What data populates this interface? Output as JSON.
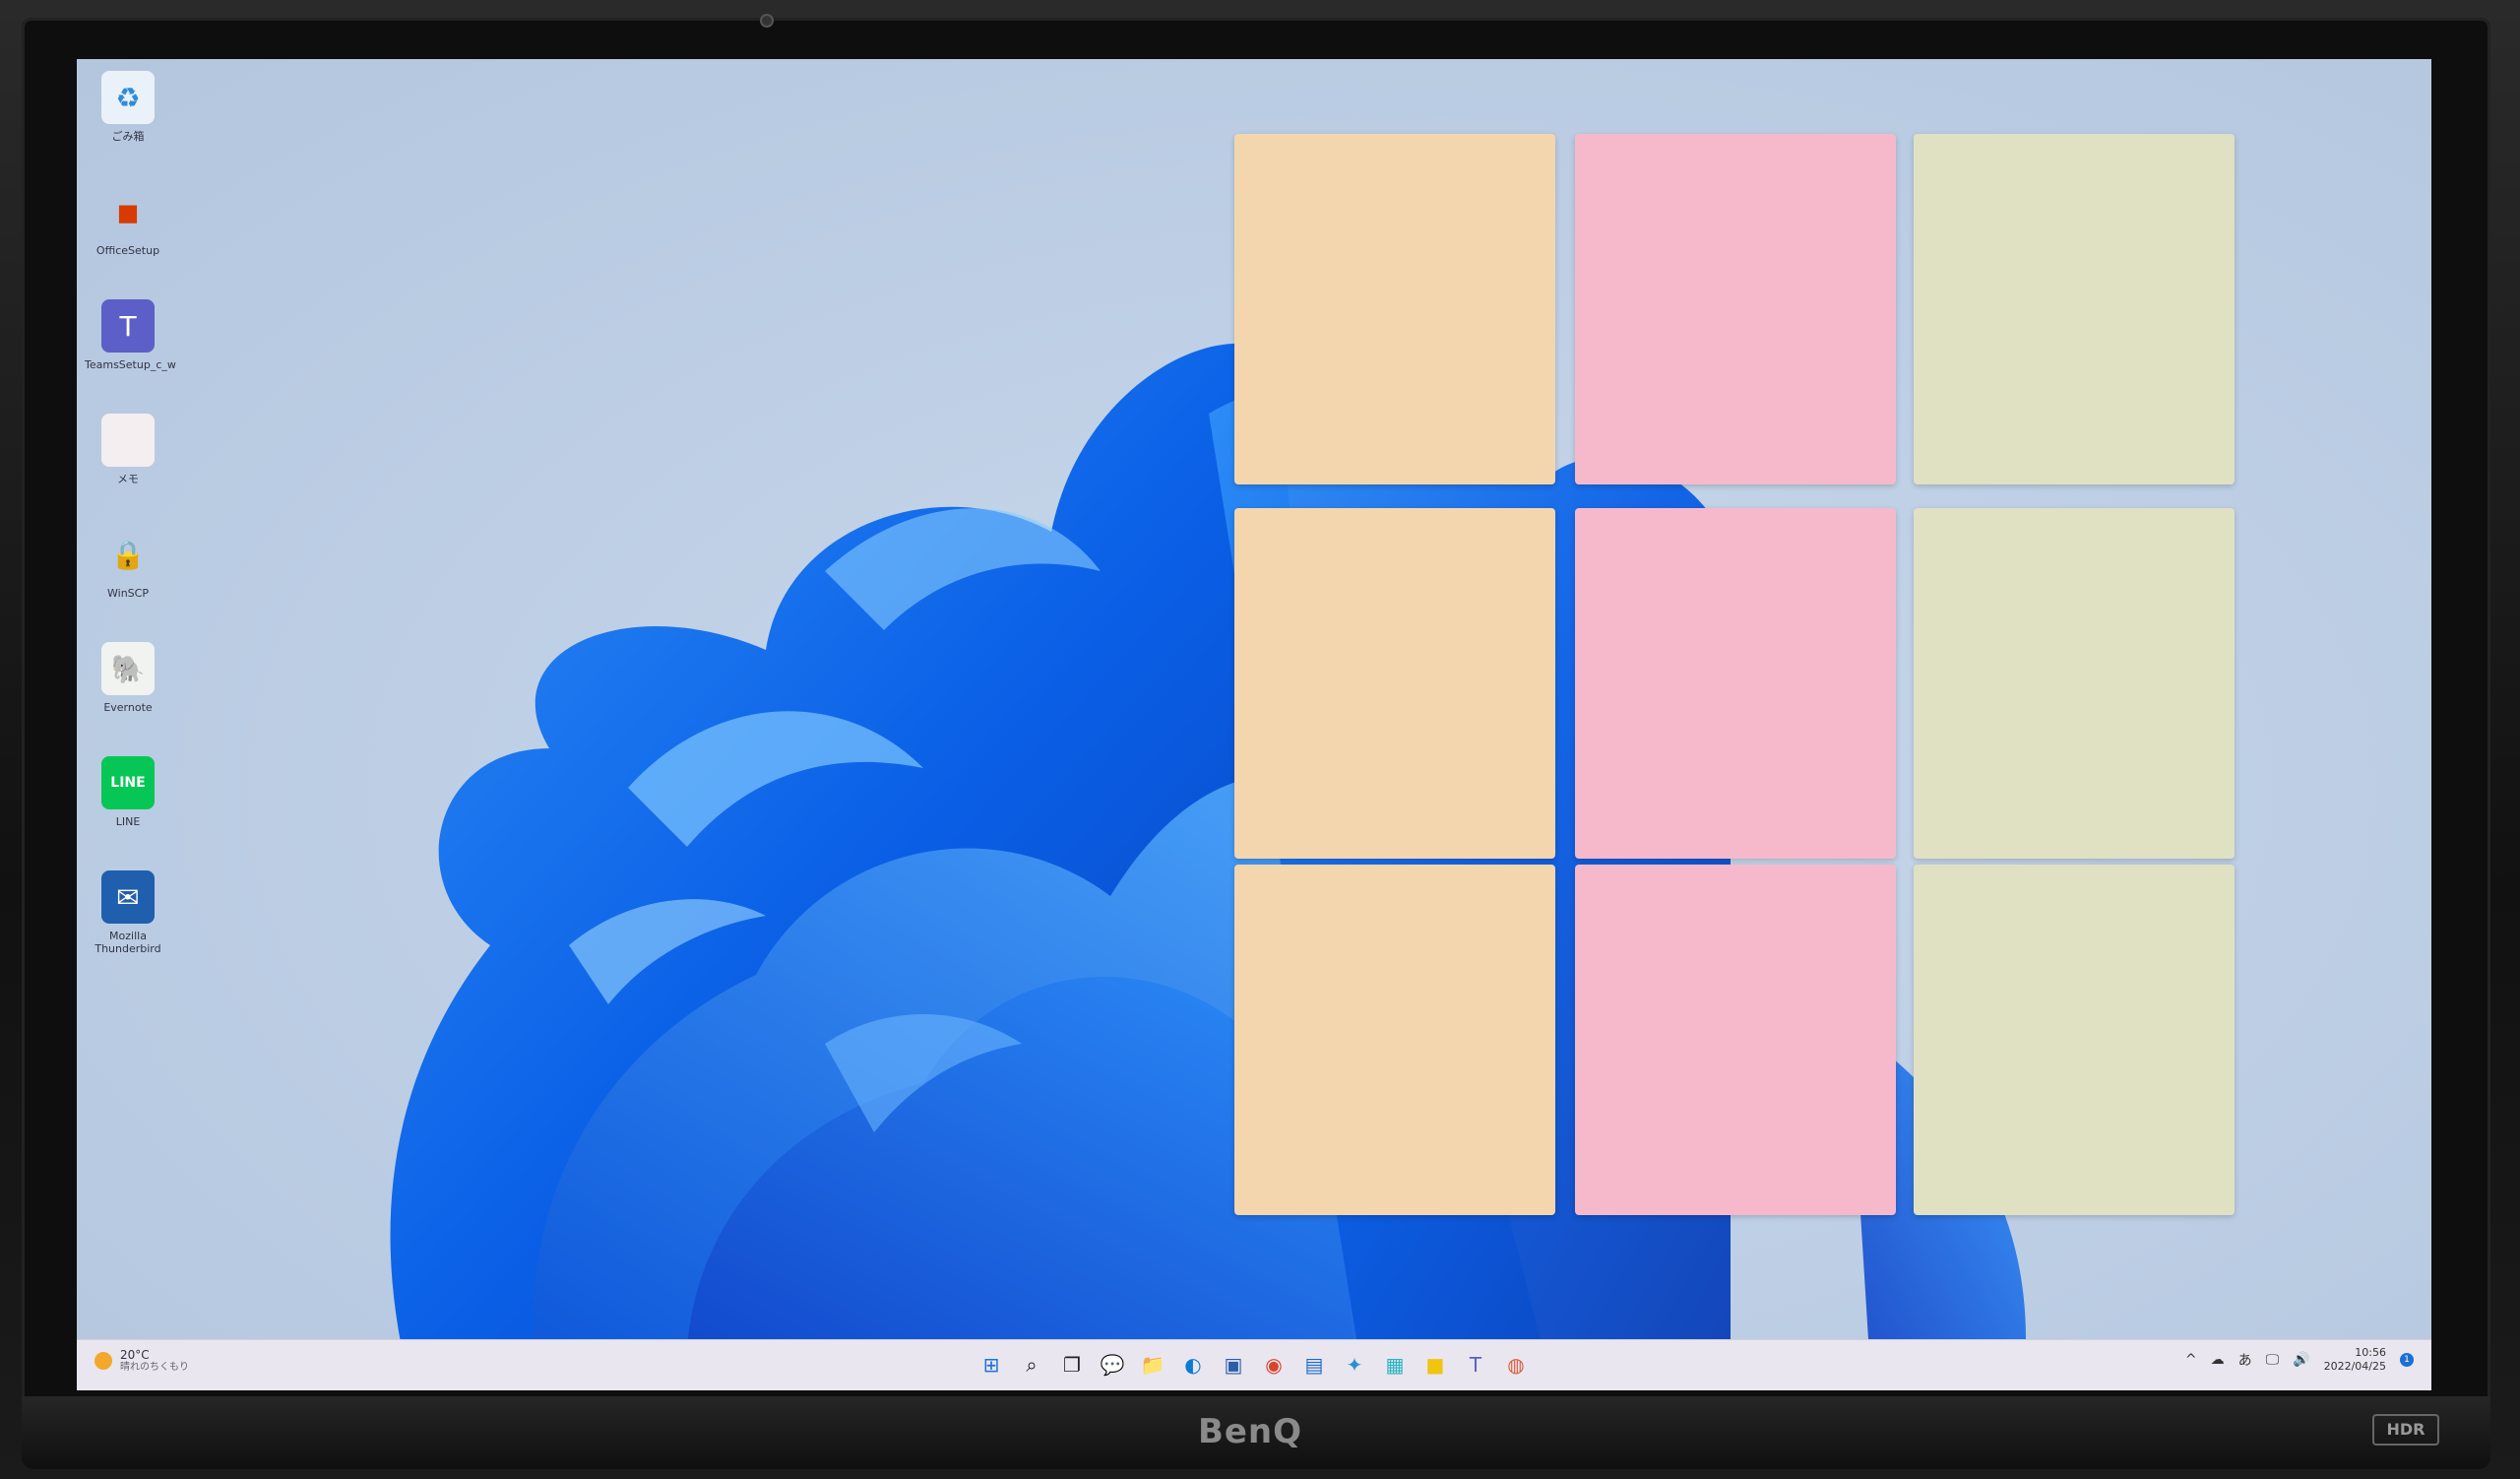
{
  "desktop": {
    "icons": [
      {
        "name": "recycle-bin-icon",
        "label": "ごみ箱",
        "glyph": "♻",
        "bg": "#eaf1f9",
        "fg": "#2f8bd8"
      },
      {
        "name": "office-setup-icon",
        "label": "OfficeSetup",
        "glyph": "◼",
        "bg": "transparent",
        "fg": "#d83b01"
      },
      {
        "name": "teams-setup-icon",
        "label": "TeamsSetup_c_w",
        "glyph": "T",
        "bg": "#5b5fc7",
        "fg": "#ffffff"
      },
      {
        "name": "blank-file-icon",
        "label": "メモ",
        "glyph": "",
        "bg": "#f4eef0",
        "fg": "#999999"
      },
      {
        "name": "winscp-icon",
        "label": "WinSCP",
        "glyph": "🔒",
        "bg": "transparent",
        "fg": "#555555"
      },
      {
        "name": "evernote-icon",
        "label": "Evernote",
        "glyph": "🐘",
        "bg": "#f1f3f1",
        "fg": "#1fa844"
      },
      {
        "name": "line-icon",
        "label": "LINE",
        "glyph": "LINE",
        "bg": "#06c755",
        "fg": "#ffffff"
      },
      {
        "name": "thunderbird-icon",
        "label": "Mozilla Thunderbird",
        "glyph": "✉",
        "bg": "#1f5fae",
        "fg": "#ffffff"
      }
    ]
  },
  "sticky_notes": {
    "colors": {
      "peach": "#f4d6ae",
      "pink": "#f6b9cc",
      "sage": "#dfe1c2"
    },
    "grid": [
      [
        "peach",
        "pink",
        "sage"
      ],
      [
        "peach",
        "pink",
        "sage"
      ],
      [
        "peach",
        "pink",
        "sage"
      ]
    ]
  },
  "taskbar": {
    "weather": {
      "temp": "20°C",
      "desc": "晴れのちくもり"
    },
    "apps": [
      {
        "name": "start-button",
        "glyph": "⊞",
        "color": "#1a73d9"
      },
      {
        "name": "search-button",
        "glyph": "⌕",
        "color": "#222222"
      },
      {
        "name": "task-view-button",
        "glyph": "❐",
        "color": "#222222"
      },
      {
        "name": "chat-button",
        "glyph": "💬",
        "color": "#6264a7"
      },
      {
        "name": "file-explorer-button",
        "glyph": "📁",
        "color": "#f2b632"
      },
      {
        "name": "edge-button",
        "glyph": "◐",
        "color": "#0b7bd3"
      },
      {
        "name": "store-button",
        "glyph": "▣",
        "color": "#2a5ea8"
      },
      {
        "name": "chrome-button",
        "glyph": "◉",
        "color": "#d9442b"
      },
      {
        "name": "remote-desktop-button",
        "glyph": "▤",
        "color": "#1b6ac9"
      },
      {
        "name": "app-button",
        "glyph": "✦",
        "color": "#2a8fd6"
      },
      {
        "name": "notepad-button",
        "glyph": "▦",
        "color": "#2bb3c0"
      },
      {
        "name": "sticky-notes-button",
        "glyph": "■",
        "color": "#f1c40f"
      },
      {
        "name": "teams-button",
        "glyph": "T",
        "color": "#5b5fc7"
      },
      {
        "name": "paint-button",
        "glyph": "◍",
        "color": "#e0593a"
      }
    ],
    "tray": {
      "chevron": "^",
      "ime": "あ",
      "time": "10:56",
      "date": "2022/04/25",
      "notifications": "1"
    }
  },
  "monitor": {
    "brand": "BenQ",
    "hdr": "HDR"
  }
}
